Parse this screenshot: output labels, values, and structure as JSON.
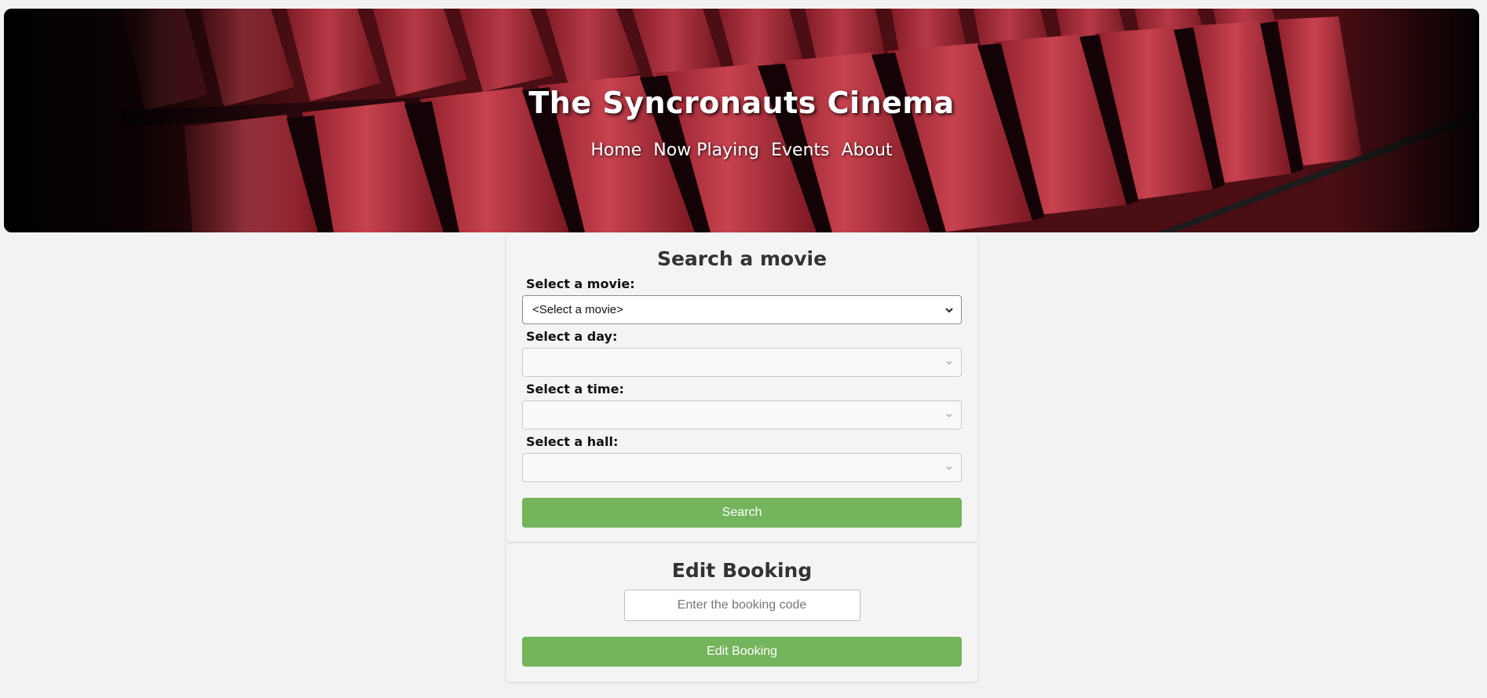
{
  "header": {
    "title": "The Syncronauts Cinema",
    "nav": [
      {
        "label": "Home"
      },
      {
        "label": "Now Playing"
      },
      {
        "label": "Events"
      },
      {
        "label": "About"
      }
    ]
  },
  "search": {
    "heading": "Search a movie",
    "movie_label": "Select a movie:",
    "movie_value": "<Select a movie>",
    "day_label": "Select a day:",
    "day_value": "",
    "time_label": "Select a time:",
    "time_value": "",
    "hall_label": "Select a hall:",
    "hall_value": "",
    "button_label": "Search"
  },
  "edit": {
    "heading": "Edit Booking",
    "input_placeholder": "Enter the booking code",
    "button_label": "Edit Booking"
  },
  "colors": {
    "button_green": "#74b45c",
    "background": "#f2f2f2",
    "seat_red": "#b8323f"
  },
  "icons": [
    "chevron-down-icon"
  ]
}
